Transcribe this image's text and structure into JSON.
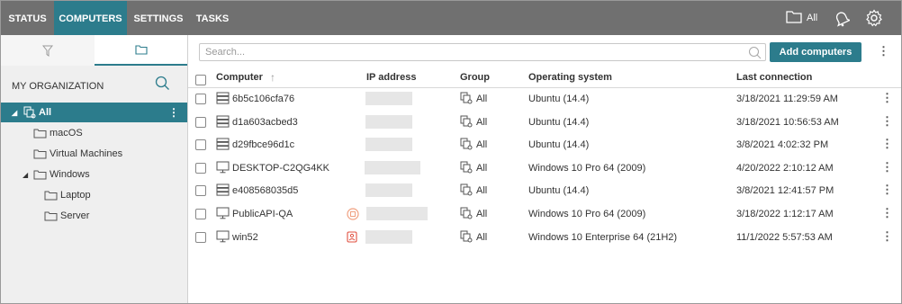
{
  "nav": {
    "tabs": [
      "STATUS",
      "COMPUTERS",
      "SETTINGS",
      "TASKS"
    ],
    "active": "COMPUTERS",
    "filter_label": "All"
  },
  "sidebar": {
    "org_title": "MY ORGANIZATION",
    "tree": [
      {
        "label": "All",
        "level": 0,
        "selected": true
      },
      {
        "label": "macOS",
        "level": 1
      },
      {
        "label": "Virtual Machines",
        "level": 1
      },
      {
        "label": "Windows",
        "level": 1
      },
      {
        "label": "Laptop",
        "level": 2
      },
      {
        "label": "Server",
        "level": 2
      }
    ]
  },
  "search": {
    "placeholder": "Search..."
  },
  "toolbar": {
    "add_label": "Add computers"
  },
  "table": {
    "headers": {
      "computer": "Computer",
      "ip": "IP address",
      "group": "Group",
      "os": "Operating system",
      "last": "Last connection"
    },
    "rows": [
      {
        "name": "6b5c106cfa76",
        "type": "server",
        "group": "All",
        "os": "Ubuntu (14.4)",
        "last": "3/18/2021 11:29:59 AM"
      },
      {
        "name": "d1a603acbed3",
        "type": "server",
        "group": "All",
        "os": "Ubuntu (14.4)",
        "last": "3/18/2021 10:56:53 AM"
      },
      {
        "name": "d29fbce96d1c",
        "type": "server",
        "group": "All",
        "os": "Ubuntu (14.4)",
        "last": "3/8/2021 4:02:32 PM"
      },
      {
        "name": "DESKTOP-C2QG4KK",
        "type": "desktop",
        "group": "All",
        "os": "Windows 10 Pro 64 (2009)",
        "last": "4/20/2022 2:10:12 AM"
      },
      {
        "name": "e408568035d5",
        "type": "server",
        "group": "All",
        "os": "Ubuntu (14.4)",
        "last": "3/8/2021 12:41:57 PM"
      },
      {
        "name": "PublicAPI-QA",
        "type": "desktop",
        "group": "All",
        "os": "Windows 10 Pro 64 (2009)",
        "last": "3/18/2022 1:12:17 AM",
        "status": "warning"
      },
      {
        "name": "win52",
        "type": "desktop",
        "group": "All",
        "os": "Windows 10 Enterprise 64 (21H2)",
        "last": "11/1/2022 5:57:53 AM",
        "status": "alert"
      }
    ]
  },
  "colors": {
    "accent": "#2c7c8c",
    "topbar": "#707070",
    "warning": "#f0a080",
    "alert": "#e05040"
  }
}
